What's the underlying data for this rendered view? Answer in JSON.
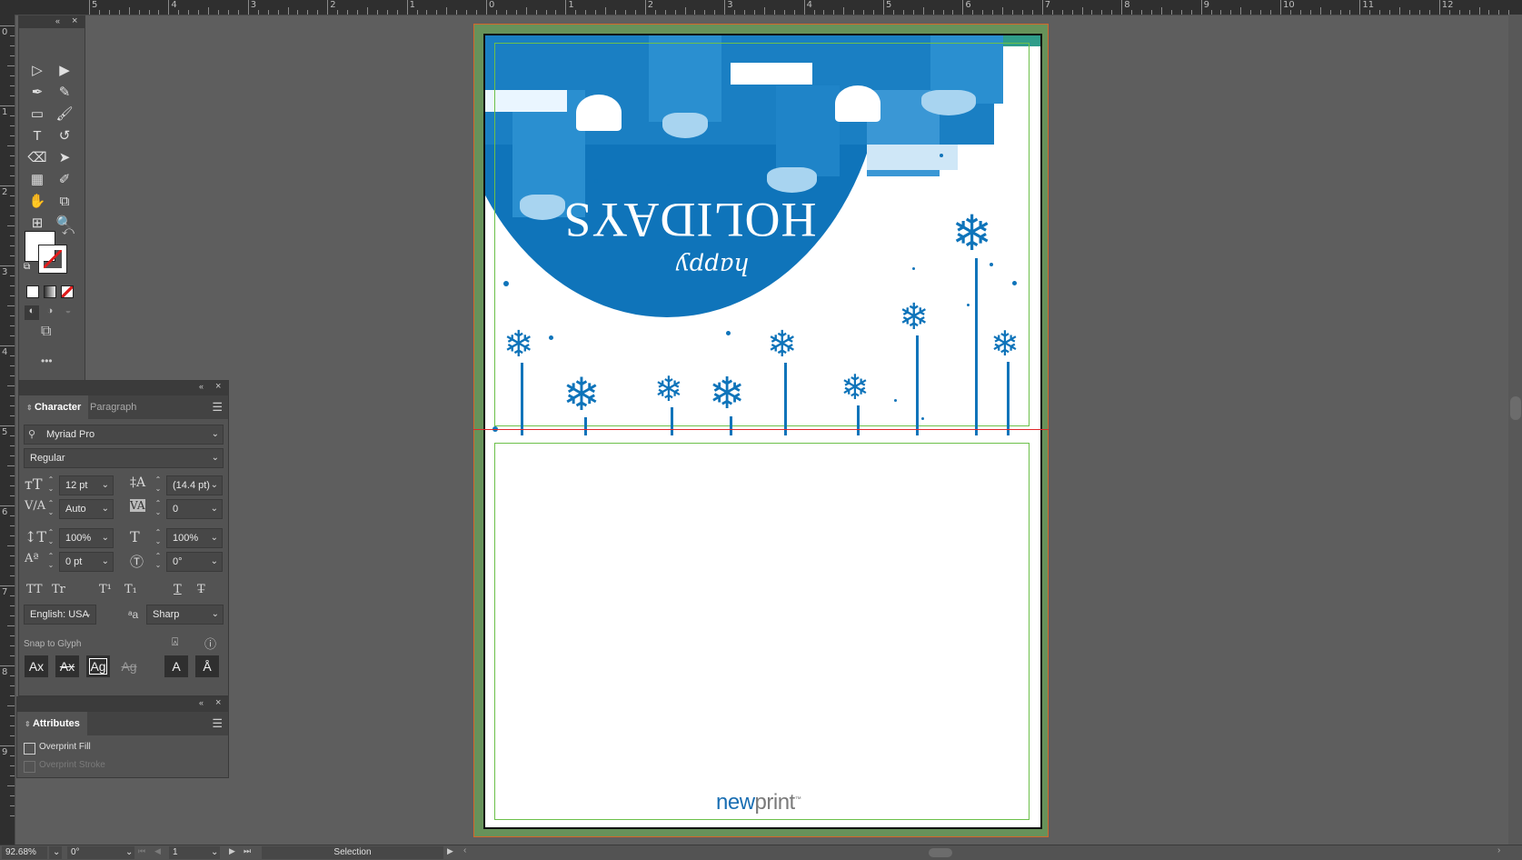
{
  "rulers": {
    "top_labels": [
      "5",
      "4",
      "3",
      "2",
      "1",
      "0",
      "1",
      "2",
      "3",
      "4",
      "5",
      "6",
      "7",
      "8",
      "9",
      "10",
      "11",
      "12"
    ],
    "left_labels": [
      "0",
      "1",
      "2",
      "3",
      "4",
      "5",
      "6",
      "7",
      "8",
      "9"
    ]
  },
  "tools_panel": {
    "tools": [
      {
        "name": "selection-tool",
        "glyph": "▷"
      },
      {
        "name": "direct-selection-tool",
        "glyph": "▶"
      },
      {
        "name": "pen-tool",
        "glyph": "✒"
      },
      {
        "name": "curvature-tool",
        "glyph": "✎"
      },
      {
        "name": "rectangle-tool",
        "glyph": "▭"
      },
      {
        "name": "paintbrush-tool",
        "glyph": "🖌"
      },
      {
        "name": "type-tool",
        "glyph": "T"
      },
      {
        "name": "rotate-tool",
        "glyph": "↺"
      },
      {
        "name": "eraser-tool",
        "glyph": "⌫"
      },
      {
        "name": "lasso-tool",
        "glyph": "➤"
      },
      {
        "name": "gradient-tool",
        "glyph": "▦"
      },
      {
        "name": "eyedropper-tool",
        "glyph": "✐"
      },
      {
        "name": "puppet-warp-tool",
        "glyph": "✋"
      },
      {
        "name": "shape-builder-tool",
        "glyph": "⧉"
      },
      {
        "name": "artboard-tool",
        "glyph": "⊞"
      },
      {
        "name": "zoom-tool",
        "glyph": "🔍"
      }
    ],
    "more_label": "•••",
    "fill_color": "#ffffff",
    "stroke_color": "none"
  },
  "character_panel": {
    "tabs": [
      "Character",
      "Paragraph"
    ],
    "font_family": "Myriad Pro",
    "font_style": "Regular",
    "font_size": "12 pt",
    "leading": "(14.4 pt)",
    "kerning": "Auto",
    "tracking": "0",
    "vertical_scale": "100%",
    "horizontal_scale": "100%",
    "baseline_shift": "0 pt",
    "rotation": "0°",
    "language": "English: USA",
    "anti_alias": "Sharp",
    "snap_to_glyph_label": "Snap to Glyph",
    "type_buttons": [
      "TT",
      "Tr",
      "T¹",
      "T₁",
      "T",
      "T̶"
    ],
    "glyph_buttons": [
      "Ax",
      "Ax",
      "Ag",
      "Ag",
      "A",
      "Å"
    ]
  },
  "attributes_panel": {
    "title": "Attributes",
    "overprint_fill": "Overprint Fill",
    "overprint_stroke": "Overprint Stroke",
    "overprint_fill_checked": false,
    "overprint_stroke_checked": false
  },
  "artboard": {
    "headline": "HOLIDAYS",
    "script_text": "happy",
    "logo_part1": "new",
    "logo_part2": "print",
    "logo_tm": "™",
    "colors": {
      "blue": "#0f74ba",
      "light_blue": "#a8d4f0",
      "guide": "#6cc04a",
      "fold": "#e0292b",
      "bleed": "#67925a"
    }
  },
  "status_bar": {
    "zoom": "92.68%",
    "rotation": "0°",
    "artboard_number": "1",
    "tool": "Selection"
  }
}
